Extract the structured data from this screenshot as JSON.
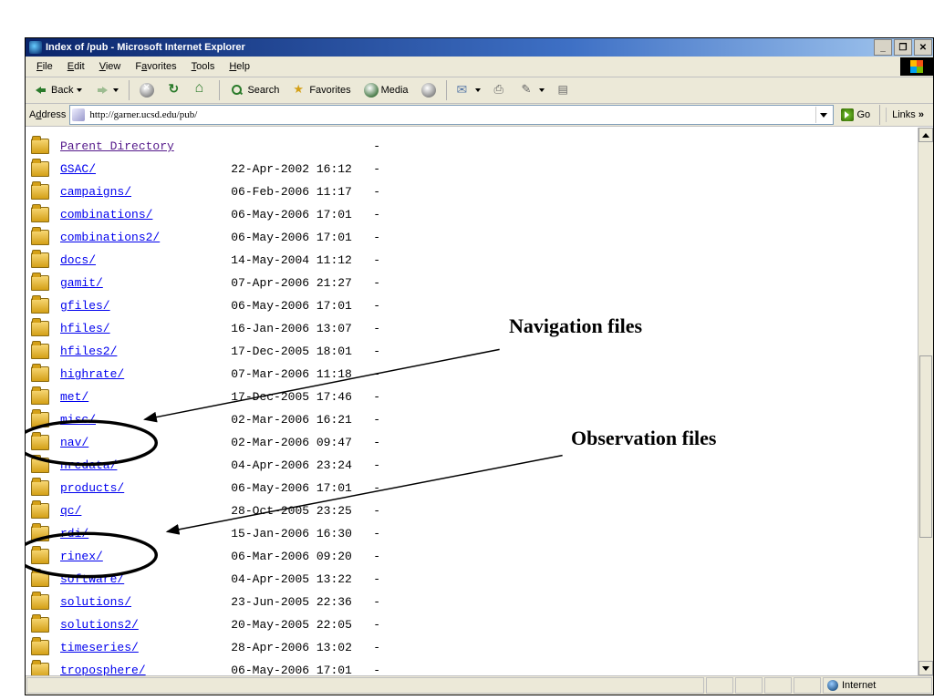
{
  "window": {
    "title": "Index of /pub - Microsoft Internet Explorer"
  },
  "menu": {
    "file": "File",
    "edit": "Edit",
    "view": "View",
    "favorites": "Favorites",
    "tools": "Tools",
    "help": "Help"
  },
  "toolbar": {
    "back": "Back",
    "search": "Search",
    "favorites": "Favorites",
    "media": "Media"
  },
  "address": {
    "label": "Address",
    "url": "http://garner.ucsd.edu/pub/",
    "go": "Go",
    "links": "Links"
  },
  "listing": {
    "parent": "Parent Directory",
    "rows": [
      {
        "name": "GSAC/",
        "date": "22-Apr-2002 16:12",
        "size": "-"
      },
      {
        "name": "campaigns/",
        "date": "06-Feb-2006 11:17",
        "size": "-"
      },
      {
        "name": "combinations/",
        "date": "06-May-2006 17:01",
        "size": "-"
      },
      {
        "name": "combinations2/",
        "date": "06-May-2006 17:01",
        "size": "-"
      },
      {
        "name": "docs/",
        "date": "14-May-2004 11:12",
        "size": "-"
      },
      {
        "name": "gamit/",
        "date": "07-Apr-2006 21:27",
        "size": "-"
      },
      {
        "name": "gfiles/",
        "date": "06-May-2006 17:01",
        "size": "-"
      },
      {
        "name": "hfiles/",
        "date": "16-Jan-2006 13:07",
        "size": "-"
      },
      {
        "name": "hfiles2/",
        "date": "17-Dec-2005 18:01",
        "size": "-"
      },
      {
        "name": "highrate/",
        "date": "07-Mar-2006 11:18",
        "size": "-"
      },
      {
        "name": "met/",
        "date": "17-Dec-2005 17:46",
        "size": "-"
      },
      {
        "name": "misc/",
        "date": "02-Mar-2006 16:21",
        "size": "-"
      },
      {
        "name": "nav/",
        "date": "02-Mar-2006 09:47",
        "size": "-"
      },
      {
        "name": "nredata/",
        "date": "04-Apr-2006 23:24",
        "size": "-"
      },
      {
        "name": "products/",
        "date": "06-May-2006 17:01",
        "size": "-"
      },
      {
        "name": "qc/",
        "date": "28-Oct-2005 23:25",
        "size": "-"
      },
      {
        "name": "rdi/",
        "date": "15-Jan-2006 16:30",
        "size": "-"
      },
      {
        "name": "rinex/",
        "date": "06-Mar-2006 09:20",
        "size": "-"
      },
      {
        "name": "software/",
        "date": "04-Apr-2005 13:22",
        "size": "-"
      },
      {
        "name": "solutions/",
        "date": "23-Jun-2005 22:36",
        "size": "-"
      },
      {
        "name": "solutions2/",
        "date": "20-May-2005 22:05",
        "size": "-"
      },
      {
        "name": "timeseries/",
        "date": "28-Apr-2006 13:02",
        "size": "-"
      },
      {
        "name": "troposphere/",
        "date": "06-May-2006 17:01",
        "size": "-"
      }
    ]
  },
  "status": {
    "zone": "Internet"
  },
  "annotations": {
    "nav": "Navigation files",
    "obs": "Observation files"
  }
}
